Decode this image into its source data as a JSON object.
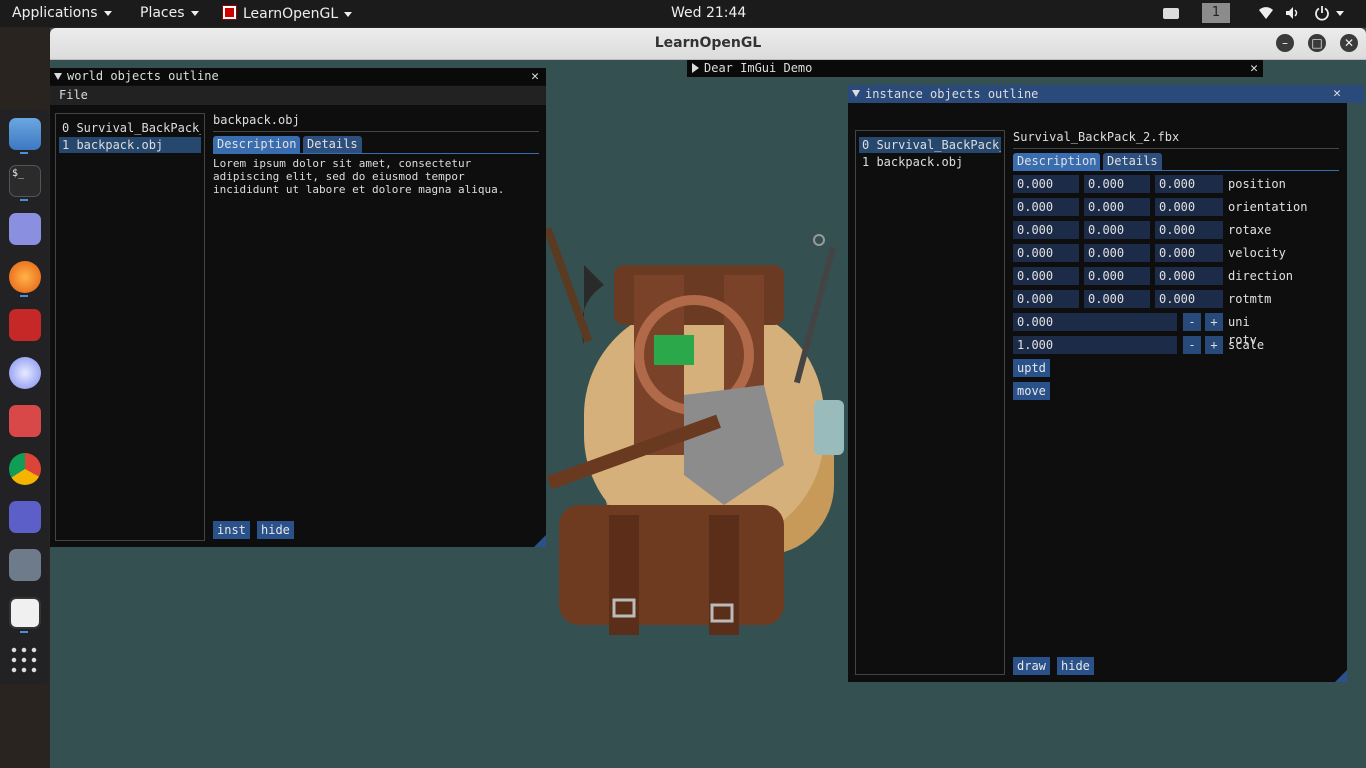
{
  "topbar": {
    "applications": "Applications",
    "places": "Places",
    "active_app": "LearnOpenGL",
    "clock": "Wed 21:44",
    "workspace": "1"
  },
  "dock": {
    "items": [
      "files-icon",
      "terminal-icon",
      "text-editor-icon",
      "firefox-icon",
      "cherry-icon",
      "media-player-icon",
      "glasses-icon",
      "chrome-icon",
      "teams-icon",
      "settings-icon",
      "learnopengl-icon",
      "app-grid-icon"
    ]
  },
  "window": {
    "title": "LearnOpenGL"
  },
  "world_outline": {
    "title": "world objects outline",
    "menu_file": "File",
    "list": [
      "0 Survival_BackPack_",
      "1 backpack.obj"
    ],
    "selected_name": "backpack.obj",
    "tab_description": "Description",
    "tab_details": "Details",
    "description_line1": "Lorem ipsum dolor sit amet, consectetur",
    "description_line2": "adipiscing elit, sed do eiusmod tempor",
    "description_line3": "incididunt ut labore et dolore magna aliqua.",
    "btn_inst": "inst",
    "btn_hide": "hide"
  },
  "demo": {
    "title": "Dear ImGui Demo"
  },
  "instance_outline": {
    "title": "instance objects outline",
    "list": [
      "0 Survival_BackPack_",
      "1 backpack.obj"
    ],
    "selected_name": "Survival_BackPack_2.fbx",
    "tab_description": "Description",
    "tab_details": "Details",
    "rows3": [
      {
        "v": [
          "0.000",
          "0.000",
          "0.000"
        ],
        "label": "position"
      },
      {
        "v": [
          "0.000",
          "0.000",
          "0.000"
        ],
        "label": "orientation"
      },
      {
        "v": [
          "0.000",
          "0.000",
          "0.000"
        ],
        "label": "rotaxe"
      },
      {
        "v": [
          "0.000",
          "0.000",
          "0.000"
        ],
        "label": "velocity"
      },
      {
        "v": [
          "0.000",
          "0.000",
          "0.000"
        ],
        "label": "direction"
      },
      {
        "v": [
          "0.000",
          "0.000",
          "0.000"
        ],
        "label": "rotmtm"
      }
    ],
    "uni_rotv": {
      "value": "0.000",
      "label": "uni rotv"
    },
    "scale": {
      "value": "1.000",
      "label": "scale"
    },
    "minus": "-",
    "plus": "+",
    "btn_uptd": "uptd",
    "btn_move": "move",
    "btn_draw": "draw",
    "btn_hide": "hide"
  },
  "colors": {
    "scene_bg": "#355050",
    "imgui_button": "#2a5189",
    "imgui_title_active": "#294a7a"
  }
}
